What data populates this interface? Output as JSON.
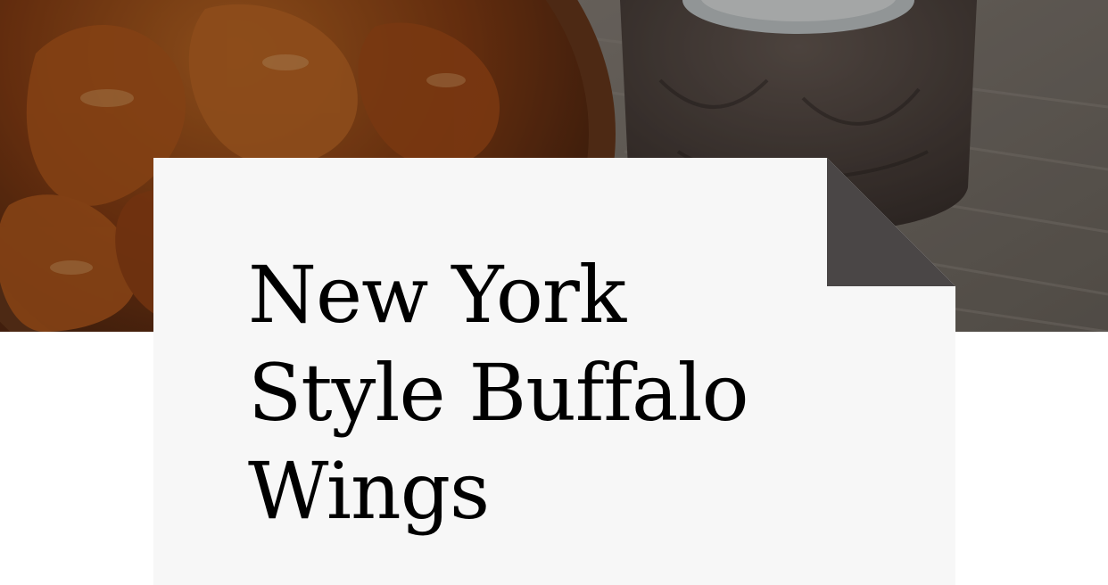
{
  "hero": {
    "image": "buffalo-wings-with-dipping-sauce-photo"
  },
  "article": {
    "title_lines": [
      "New York",
      "Style Buffalo",
      "Wings"
    ]
  },
  "colors": {
    "card_background": "#f7f7f7",
    "fold": "#4a4646",
    "title_text": "#000000",
    "page_background": "#ffffff"
  }
}
